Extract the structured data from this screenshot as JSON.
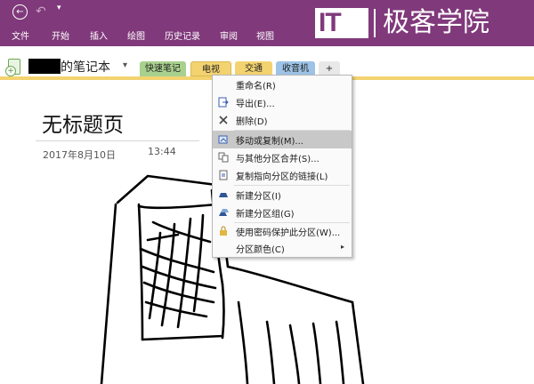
{
  "quick_access": {
    "back": "←",
    "undo": "↶",
    "more": "▾"
  },
  "menu": [
    "文件",
    "开始",
    "插入",
    "绘图",
    "历史记录",
    "审阅",
    "视图"
  ],
  "logo": {
    "it": "IT",
    "text": "极客学院"
  },
  "notebook": {
    "name_suffix": "的笔记本",
    "chevron": "▾"
  },
  "tabs": [
    {
      "label": "快速笔记",
      "color": "#a9d18e"
    },
    {
      "label": "电视",
      "color": "#f3d370"
    },
    {
      "label": "交通",
      "color": "#f3d370"
    },
    {
      "label": "收音机",
      "color": "#9dc3e6"
    },
    {
      "label": "+",
      "color": "#e8e8e8"
    }
  ],
  "page": {
    "title": "无标题页",
    "date": "2017年8月10日",
    "time": "13:44"
  },
  "context_menu": {
    "items": [
      {
        "label": "重命名(R)",
        "icon": "none"
      },
      {
        "label": "导出(E)...",
        "icon": "export-icon"
      },
      {
        "label": "删除(D)",
        "icon": "delete-x-icon"
      },
      {
        "label": "移动或复制(M)...",
        "icon": "move-copy-icon",
        "highlighted": true
      },
      {
        "label": "与其他分区合并(S)...",
        "icon": "merge-icon"
      },
      {
        "label": "复制指向分区的链接(L)",
        "icon": "copy-link-icon"
      },
      {
        "label": "新建分区(I)",
        "icon": "new-section-icon"
      },
      {
        "label": "新建分区组(G)",
        "icon": "new-section-group-icon"
      },
      {
        "label": "使用密码保护此分区(W)...",
        "icon": "lock-icon"
      },
      {
        "label": "分区颜色(C)",
        "icon": "none",
        "submenu_arrow": "▸"
      }
    ]
  },
  "colors": {
    "ribbon": "#80397b",
    "highlight": "#c8c8c8",
    "section_line": "#f3d370"
  }
}
